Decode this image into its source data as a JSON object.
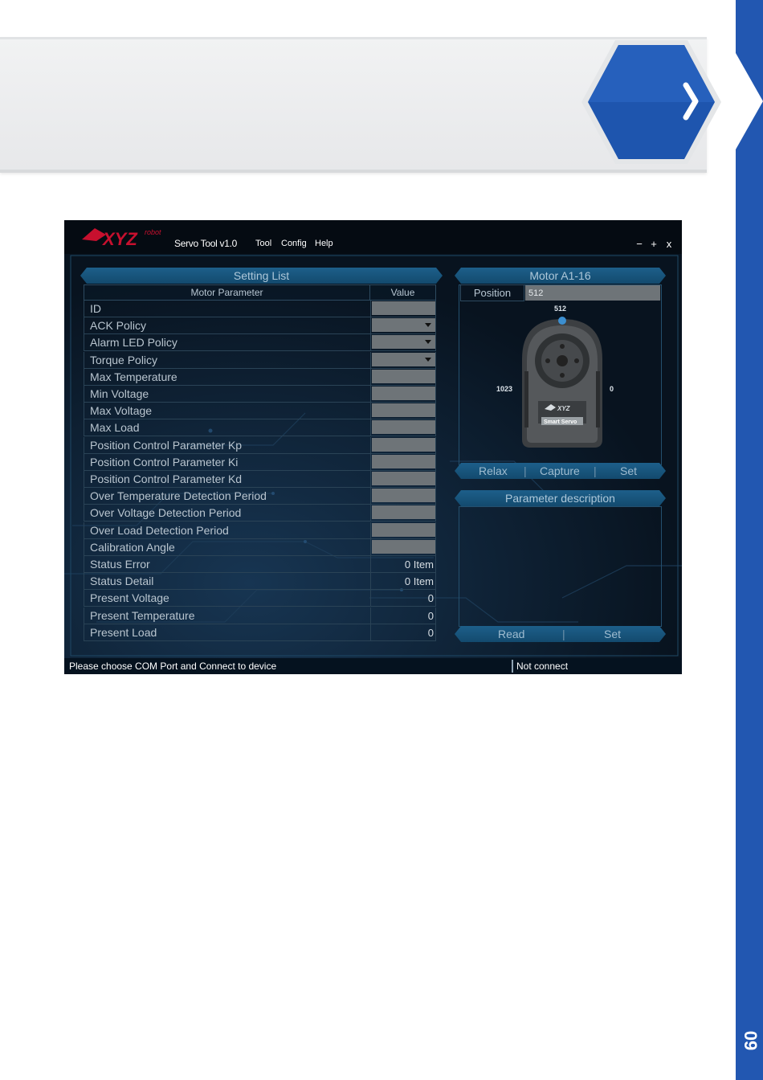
{
  "page": {
    "page_number": "09",
    "accent_color": "#2257b1"
  },
  "app": {
    "title": "Servo Tool v1.0",
    "logo_text": "XYZrobot",
    "menu": [
      "Tool",
      "Config",
      "Help"
    ],
    "window_controls": {
      "minimize": "−",
      "maximize": "+",
      "close": "x"
    }
  },
  "setting_list": {
    "title": "Setting List",
    "columns": {
      "param": "Motor Parameter",
      "value": "Value"
    },
    "rows": [
      {
        "label": "ID",
        "kind": "input",
        "value": ""
      },
      {
        "label": "ACK Policy",
        "kind": "select",
        "value": ""
      },
      {
        "label": "Alarm LED Policy",
        "kind": "select",
        "value": ""
      },
      {
        "label": "Torque Policy",
        "kind": "select",
        "value": ""
      },
      {
        "label": "Max Temperature",
        "kind": "input",
        "value": ""
      },
      {
        "label": "Min Voltage",
        "kind": "input",
        "value": ""
      },
      {
        "label": "Max Voltage",
        "kind": "input",
        "value": ""
      },
      {
        "label": "Max Load",
        "kind": "input",
        "value": ""
      },
      {
        "label": "Position Control Parameter Kp",
        "kind": "input",
        "value": ""
      },
      {
        "label": "Position Control Parameter Ki",
        "kind": "input",
        "value": ""
      },
      {
        "label": "Position Control Parameter Kd",
        "kind": "input",
        "value": ""
      },
      {
        "label": "Over Temperature Detection Period",
        "kind": "input",
        "value": ""
      },
      {
        "label": "Over Voltage Detection Period",
        "kind": "input",
        "value": ""
      },
      {
        "label": "Over Load Detection Period",
        "kind": "input",
        "value": ""
      },
      {
        "label": "Calibration Angle",
        "kind": "input",
        "value": ""
      },
      {
        "label": "Status Error",
        "kind": "text",
        "value": "0  Item"
      },
      {
        "label": "Status Detail",
        "kind": "text",
        "value": "0  Item"
      },
      {
        "label": "Present Voltage",
        "kind": "text",
        "value": "0"
      },
      {
        "label": "Present Temperature",
        "kind": "text",
        "value": "0"
      },
      {
        "label": "Present Load",
        "kind": "text",
        "value": "0"
      }
    ]
  },
  "motor": {
    "title": "Motor A1-16",
    "position_label": "Position",
    "position_value": "512",
    "dial": {
      "top": "512",
      "left": "1023",
      "right": "0"
    },
    "servo_brand": "Smart Servo",
    "buttons": {
      "relax": "Relax",
      "capture": "Capture",
      "set": "Set"
    }
  },
  "description": {
    "title": "Parameter description",
    "buttons": {
      "read": "Read",
      "set": "Set"
    }
  },
  "status": {
    "message": "Please choose COM Port and Connect to device",
    "connection": "Not connect"
  }
}
